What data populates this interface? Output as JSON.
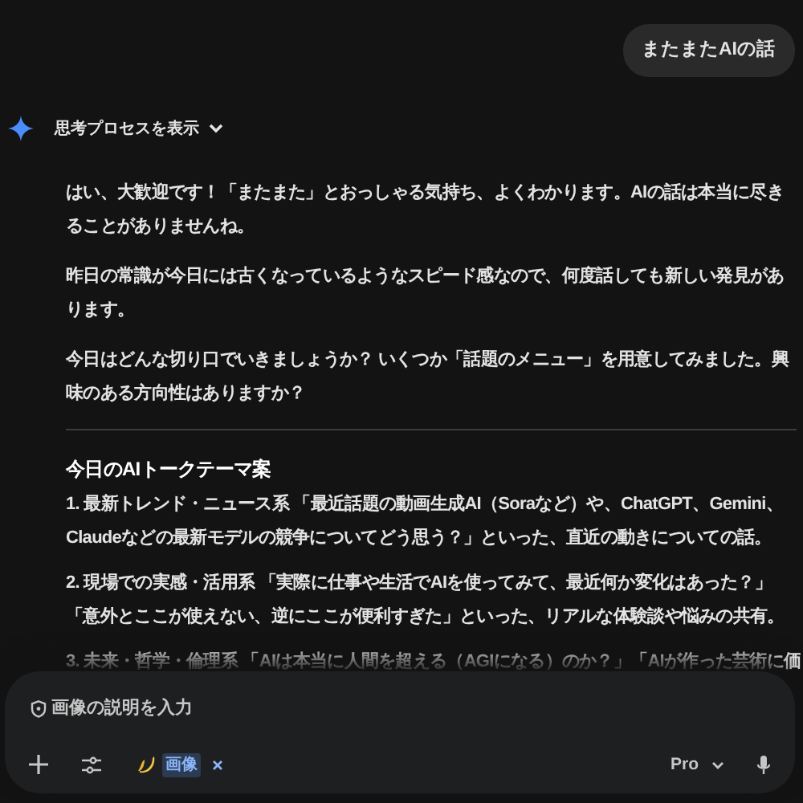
{
  "user_message": {
    "text": "またまたAIの話"
  },
  "response": {
    "thinking_toggle": {
      "label": "思考プロセスを表示",
      "expanded": false
    },
    "paragraphs": [
      "はい、大歓迎です！「またまた」とおっしゃる気持ち、よくわかります。AIの話は本当に尽きることがありませんね。",
      "昨日の常識が今日には古くなっているようなスピード感なので、何度話しても新しい発見があります。",
      "今日はどんな切り口でいきましょうか？ いくつか「話題のメニュー」を用意してみました。興味のある方向性はありますか？"
    ],
    "section_title": "今日のAIトークテーマ案",
    "topics": [
      {
        "text": "**1. 最新トレンド・ニュース系** 「最近話題の動画生成AI（Soraなど）や、ChatGPT、Gemini、Claudeなどの最新モデルの競争についてどう思う？」といった、直近の動きについての話。"
      },
      {
        "text": "**2. 現場での実感・活用系** 「実際に仕事や生活でAIを使ってみて、最近何か変化はあった？」「意外とここが使えない、逆にここが便利すぎた」といった、リアルな体験談や悩みの共有。"
      },
      {
        "text": "**3. 未来・哲学・倫理系** 「AIは本当に人間を超える（AGIになる）のか？」「AIが作った芸術に価"
      }
    ]
  },
  "composer": {
    "placeholder": "画像の説明を入力",
    "tool_chip": {
      "label": "画像"
    },
    "model": "Pro"
  }
}
